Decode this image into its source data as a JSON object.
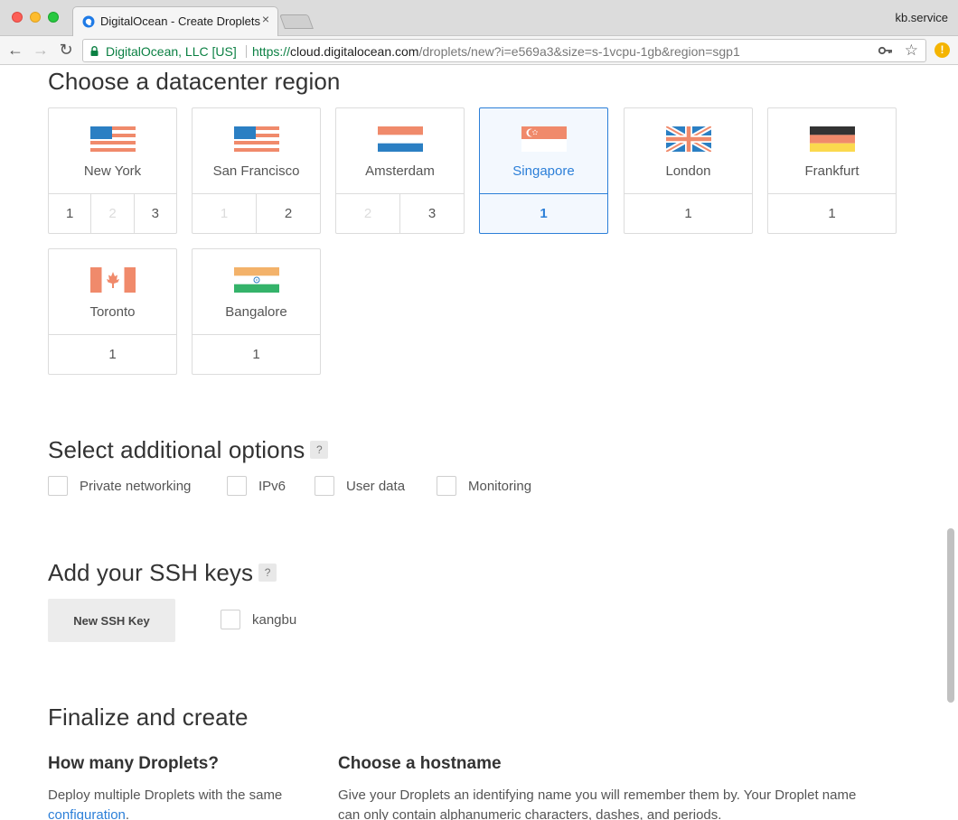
{
  "browser": {
    "tab_title": "DigitalOcean - Create Droplets",
    "tab_close": "×",
    "profile_name": "kb.service",
    "secure_label": "DigitalOcean, LLC [US]",
    "url_scheme": "https://",
    "url_host": "cloud.digitalocean.com",
    "url_path": "/droplets/new?i=e569a3&size=s-1vcpu-1gb&region=sgp1",
    "back_icon": "←",
    "forward_icon": "→",
    "reload_icon": "↻",
    "star_icon": "☆",
    "extension_badge": "!"
  },
  "datacenter": {
    "heading": "Choose a datacenter region",
    "regions": [
      {
        "name": "New York",
        "flag": "us-flag",
        "numbers": [
          "1",
          "2",
          "3"
        ],
        "disabled": [
          false,
          true,
          false
        ],
        "selected": false
      },
      {
        "name": "San Francisco",
        "flag": "us-flag",
        "numbers": [
          "1",
          "2"
        ],
        "disabled": [
          true,
          false
        ],
        "selected": false
      },
      {
        "name": "Amsterdam",
        "flag": "nl-flag",
        "numbers": [
          "2",
          "3"
        ],
        "disabled": [
          true,
          false
        ],
        "selected": false
      },
      {
        "name": "Singapore",
        "flag": "sg-flag",
        "numbers": [
          "1"
        ],
        "disabled": [
          false
        ],
        "selected": true
      },
      {
        "name": "London",
        "flag": "uk-flag",
        "numbers": [
          "1"
        ],
        "disabled": [
          false
        ],
        "selected": false
      },
      {
        "name": "Frankfurt",
        "flag": "de-flag",
        "numbers": [
          "1"
        ],
        "disabled": [
          false
        ],
        "selected": false
      },
      {
        "name": "Toronto",
        "flag": "ca-flag",
        "numbers": [
          "1"
        ],
        "disabled": [
          false
        ],
        "selected": false
      },
      {
        "name": "Bangalore",
        "flag": "in-flag",
        "numbers": [
          "1"
        ],
        "disabled": [
          false
        ],
        "selected": false
      }
    ],
    "selected_color": "#2c7fd8"
  },
  "options": {
    "heading": "Select additional options",
    "help": "?",
    "items": [
      {
        "label": "Private networking",
        "checked": false
      },
      {
        "label": "IPv6",
        "checked": false
      },
      {
        "label": "User data",
        "checked": false
      },
      {
        "label": "Monitoring",
        "checked": false
      }
    ]
  },
  "ssh": {
    "heading": "Add your SSH keys",
    "help": "?",
    "new_key_button": "New SSH Key",
    "keys": [
      {
        "label": "kangbu",
        "checked": false
      }
    ]
  },
  "finalize": {
    "heading": "Finalize and create",
    "count_heading": "How many Droplets?",
    "count_text": "Deploy multiple Droplets with the same",
    "count_link": "configuration",
    "count_text_end": ".",
    "hostname_heading": "Choose a hostname",
    "hostname_text_1": "Give your Droplets an identifying name you will remember them by. Your Droplet name",
    "hostname_text_2": "can only contain alphanumeric characters, dashes, and periods."
  }
}
